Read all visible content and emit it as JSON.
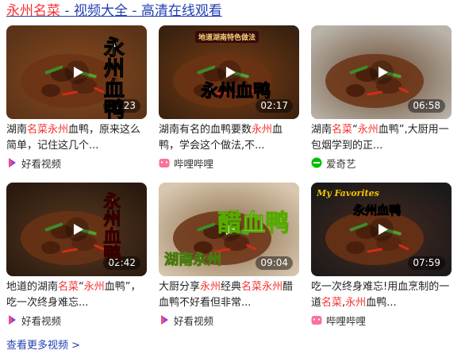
{
  "header": {
    "part1": "永州名菜",
    "part2": " - 视频大全 - 高清在线观看"
  },
  "videos": [
    {
      "duration": "03:23",
      "overlay": "永州血鸭",
      "title": [
        {
          "t": "湖南",
          "hl": false
        },
        {
          "t": "名菜",
          "hl": true
        },
        {
          "t": "永州",
          "hl": true
        },
        {
          "t": "血鸭，原来这么简单，记住这几个...",
          "hl": false
        }
      ],
      "source": "好看视频",
      "source_icon": "haokan-icon",
      "bg": [
        "#5a3318",
        "#8a4a20"
      ]
    },
    {
      "duration": "02:17",
      "overlay": "永州血鸭",
      "banner": "地道湖南特色做法",
      "title": [
        {
          "t": "湖南有名的血鸭要数",
          "hl": false
        },
        {
          "t": "永州",
          "hl": true
        },
        {
          "t": "血鸭，学会这个做法,不...",
          "hl": false
        }
      ],
      "source": "哔哩哔哩",
      "source_icon": "bilibili-icon",
      "bg": [
        "#3a2210",
        "#7a3d15"
      ]
    },
    {
      "duration": "06:58",
      "title": [
        {
          "t": "湖南",
          "hl": false
        },
        {
          "t": "名菜",
          "hl": true
        },
        {
          "t": "“",
          "hl": false
        },
        {
          "t": "永州",
          "hl": true
        },
        {
          "t": "血鸭”,大厨用一包烟学到的正...",
          "hl": false
        }
      ],
      "source": "爱奇艺",
      "source_icon": "iqiyi-icon",
      "bg": [
        "#b9b3aa",
        "#6a4a30"
      ]
    },
    {
      "duration": "02:42",
      "overlay": "永州血鸭",
      "title": [
        {
          "t": "地道的湖南",
          "hl": false
        },
        {
          "t": "名菜",
          "hl": true
        },
        {
          "t": "“",
          "hl": false
        },
        {
          "t": "永州",
          "hl": true
        },
        {
          "t": "血鸭”，吃一次终身难忘...",
          "hl": false
        }
      ],
      "source": "好看视频",
      "source_icon": "haokan-icon",
      "bg": [
        "#2a1a10",
        "#5a3a20"
      ]
    },
    {
      "duration": "09:04",
      "overlay": "醋血鸭",
      "banner": "湖南永州",
      "title": [
        {
          "t": "大厨分享",
          "hl": false
        },
        {
          "t": "永州",
          "hl": true
        },
        {
          "t": "经典",
          "hl": false
        },
        {
          "t": "名菜",
          "hl": true
        },
        {
          "t": "永州",
          "hl": true
        },
        {
          "t": "醋血鸭不好看但非常...",
          "hl": false
        }
      ],
      "source": "好看视频",
      "source_icon": "haokan-icon",
      "bg": [
        "#d8c8b0",
        "#8a6a48"
      ]
    },
    {
      "duration": "07:59",
      "overlay": "永州血鸭",
      "banner": "My Favorites",
      "title": [
        {
          "t": "吃一次终身难忘!用血烹制的一道",
          "hl": false
        },
        {
          "t": "名菜",
          "hl": true
        },
        {
          "t": ",",
          "hl": false
        },
        {
          "t": "永州",
          "hl": true
        },
        {
          "t": "血鸭...",
          "hl": false
        }
      ],
      "source": "哔哩哔哩",
      "source_icon": "bilibili-icon",
      "bg": [
        "#1a1a1a",
        "#4a2a20"
      ]
    }
  ],
  "more_link": "查看更多视频 >",
  "colors": {
    "link": "#2440b3",
    "highlight": "#f73131",
    "haokan": "#7b3dfa",
    "bilibili": "#fb7299",
    "iqiyi": "#00be06"
  }
}
